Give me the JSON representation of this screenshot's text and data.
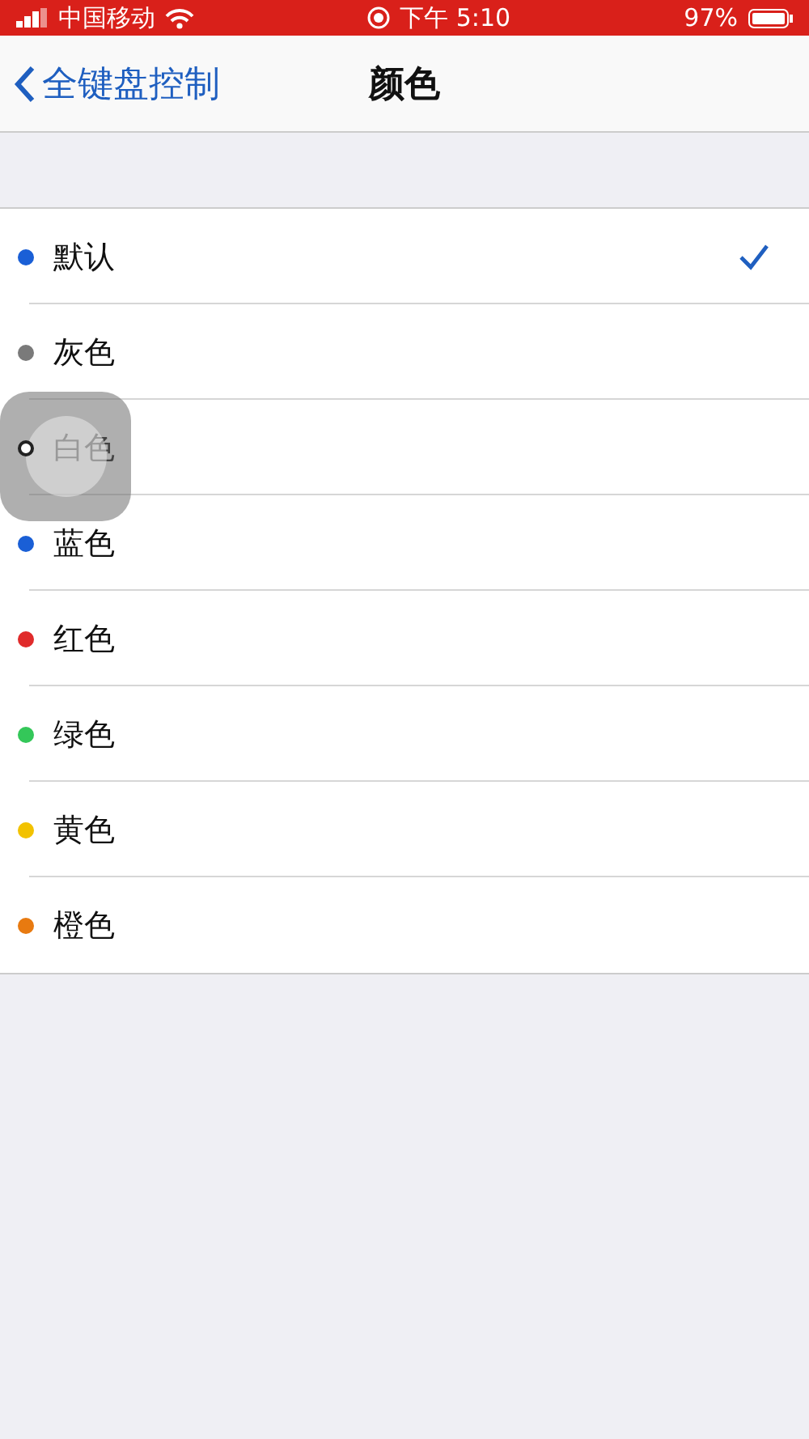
{
  "status_bar": {
    "carrier": "中国移动",
    "time": "下午 5:10",
    "battery": "97%"
  },
  "nav": {
    "back": "全键盘控制",
    "title": "颜色"
  },
  "colors": [
    {
      "label": "默认",
      "color": "#1a5fd6",
      "selected": true
    },
    {
      "label": "灰色",
      "color": "#7a7a7a",
      "selected": false
    },
    {
      "label": "白色",
      "color": "#ffffff",
      "selected": false
    },
    {
      "label": "蓝色",
      "color": "#1a5fd6",
      "selected": false
    },
    {
      "label": "红色",
      "color": "#e02b2b",
      "selected": false
    },
    {
      "label": "绿色",
      "color": "#34c759",
      "selected": false
    },
    {
      "label": "黄色",
      "color": "#f2c200",
      "selected": false
    },
    {
      "label": "橙色",
      "color": "#e87a10",
      "selected": false
    }
  ]
}
